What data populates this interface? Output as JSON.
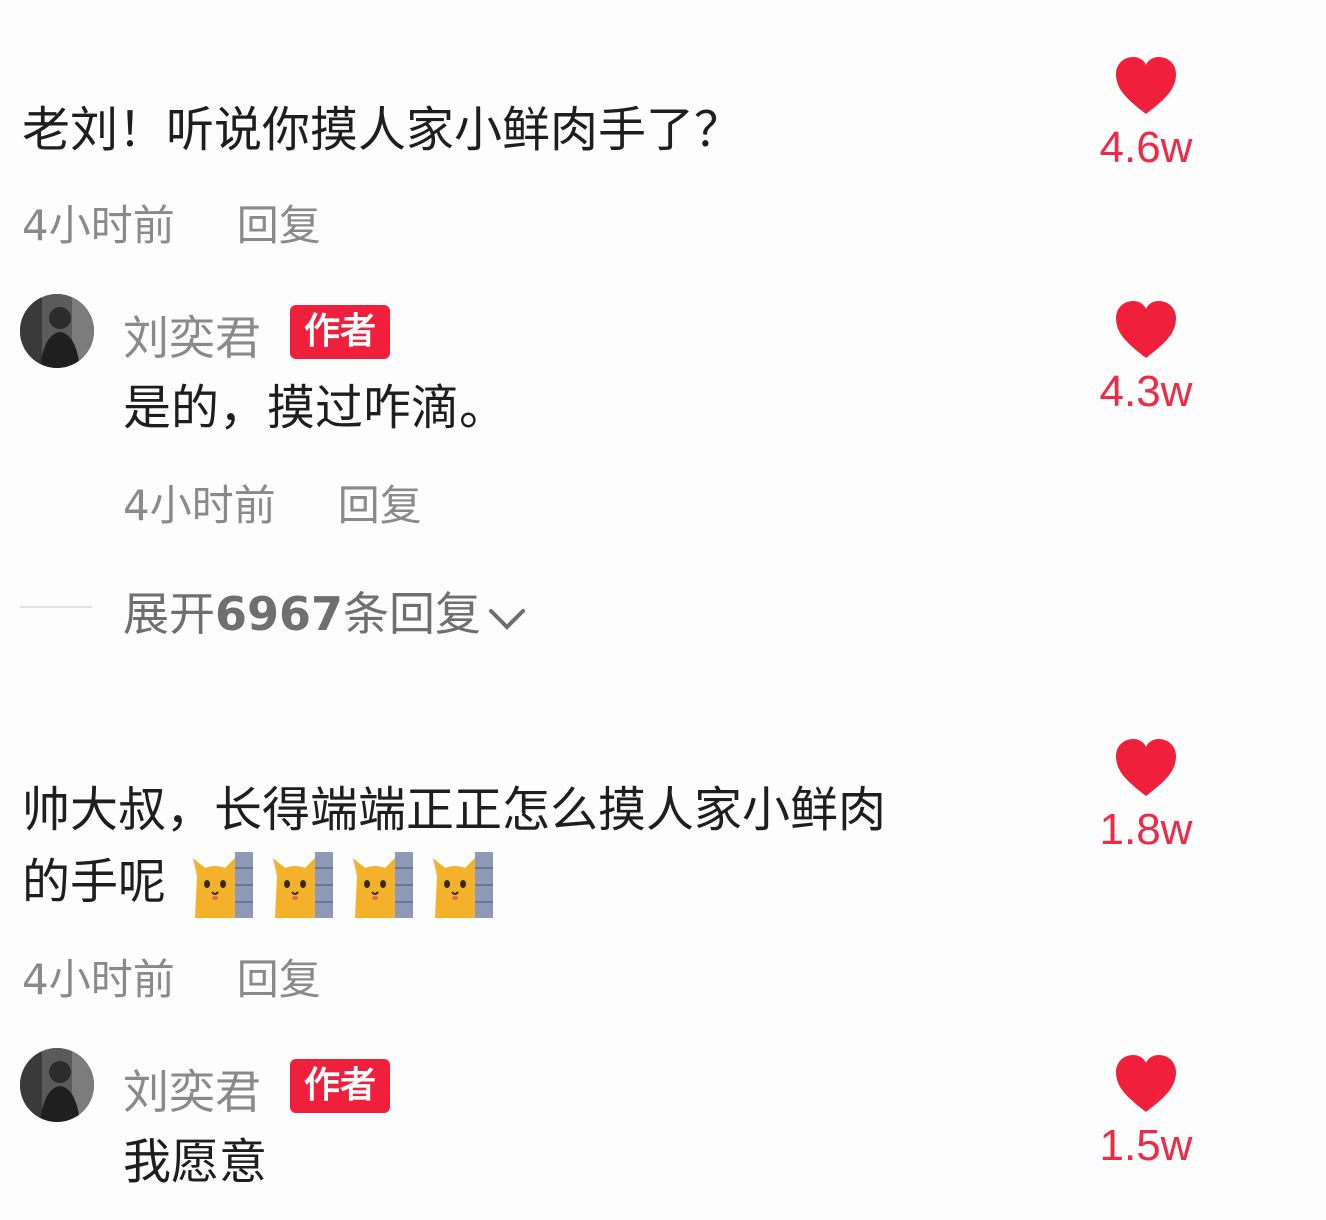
{
  "comments": [
    {
      "text": "老刘！听说你摸人家小鲜肉手了？",
      "time": "4小时前",
      "reply_label": "回复",
      "likes": "4.6w",
      "replies": [
        {
          "username": "刘奕君",
          "badge": "作者",
          "text": "是的，摸过咋滴。",
          "time": "4小时前",
          "reply_label": "回复",
          "likes": "4.3w"
        }
      ],
      "expand": {
        "prefix": "展开",
        "count": "6967",
        "suffix": "条回复"
      }
    },
    {
      "text_line1": "帅大叔，长得端端正正怎么摸人家小鲜肉",
      "text_line2": "的手呢",
      "emoji_count": 4,
      "time": "4小时前",
      "reply_label": "回复",
      "likes": "1.8w",
      "replies": [
        {
          "username": "刘奕君",
          "badge": "作者",
          "text": "我愿意",
          "likes": "1.5w"
        }
      ]
    }
  ],
  "icons": {
    "like": "heart-icon",
    "expand": "chevron-down-icon",
    "emoji": "peeking-cat-emoji"
  },
  "colors": {
    "like_red": "#ee2a46",
    "badge_red": "#f01f3c",
    "meta_gray": "#8a8a8a"
  }
}
